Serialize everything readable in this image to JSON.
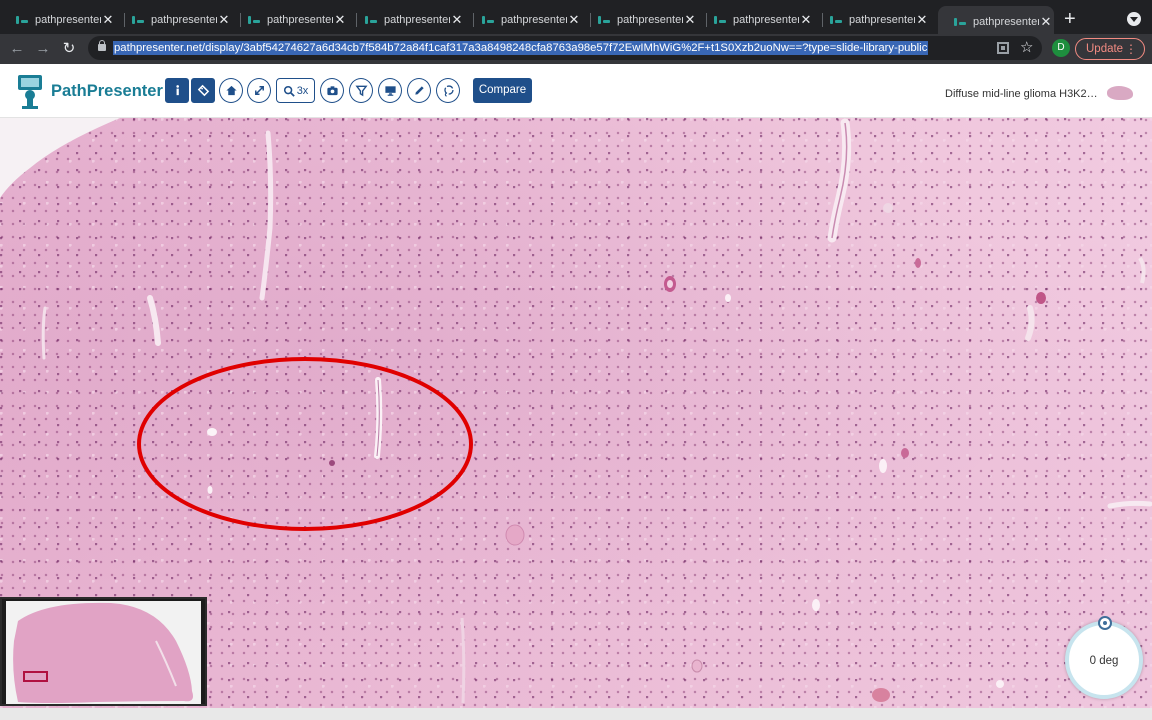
{
  "browser": {
    "tabs": [
      {
        "title": "pathpresenter",
        "close": "✕"
      },
      {
        "title": "pathpresenter",
        "close": "✕"
      },
      {
        "title": "pathpresenter",
        "close": "✕"
      },
      {
        "title": "pathpresenter",
        "close": "✕"
      },
      {
        "title": "pathpresenter",
        "close": "✕"
      },
      {
        "title": "pathpresenter",
        "close": "✕"
      },
      {
        "title": "pathpresenter",
        "close": "✕"
      },
      {
        "title": "pathpresenter",
        "close": "✕"
      },
      {
        "title": "pathpresenter",
        "close": "✕",
        "active": true
      }
    ],
    "new_tab": "+",
    "back": "←",
    "forward": "→",
    "reload": "↻",
    "url": "pathpresenter.net/display/3abf54274627a6d34cb7f584b72a84f1caf317a3a8498248cfa8763a98e57f72EwIMhWiG%2F+t1S0Xzb2uoNw==?type=slide-library-public",
    "star": "☆",
    "profile_initial": "D",
    "update_label": "Update",
    "menu": "⋮"
  },
  "app": {
    "brand": "PathPresenter",
    "zoom_label": "3x",
    "compare_label": "Compare",
    "slide_title": "Diffuse mid-line glioma H3K2…",
    "rotation_label": "0 deg",
    "toolbar_icons": [
      "info-icon",
      "tag-icon",
      "home-icon",
      "fullscreen-icon",
      "zoom-icon",
      "camera-icon",
      "filter-icon",
      "monitor-icon",
      "pencil-icon",
      "lasso-icon"
    ],
    "accent_color": "#1f4f8a",
    "brand_color": "#1a7d95",
    "annotation_color": "#e00000",
    "tissue_color": "#e9b6d2"
  }
}
